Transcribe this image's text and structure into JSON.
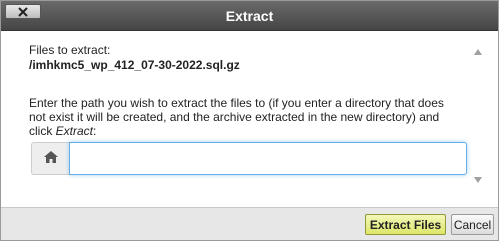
{
  "dialog": {
    "title": "Extract",
    "close_icon": "close-icon",
    "files_label": "Files to extract:",
    "filename": "/imhkmc5_wp_412_07-30-2022.sql.gz",
    "instructions_prefix": "Enter the path you wish to extract the files to (if you enter a directory that does not exist it will be created, and the archive extracted in the new directory) and click ",
    "instructions_action": "Extract",
    "instructions_suffix": ":",
    "path_input": {
      "value": "",
      "placeholder": "",
      "icon": "home-icon"
    }
  },
  "footer": {
    "extract_label": "Extract Files",
    "cancel_label": "Cancel"
  },
  "colors": {
    "titlebar": "#4f4f4f",
    "extract_button": "#e4ec88",
    "input_focus": "#66afe9",
    "footer": "#e7e7e7"
  }
}
